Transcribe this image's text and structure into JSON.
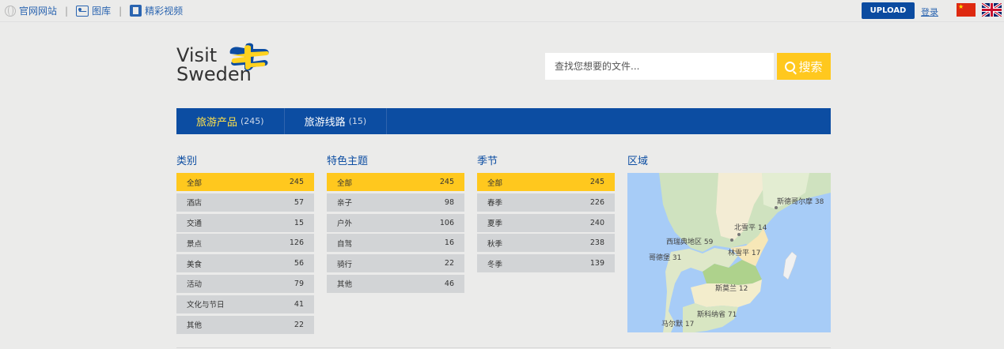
{
  "topbar": {
    "links": [
      {
        "label": "官网网站",
        "icon": "globe-icon"
      },
      {
        "label": "图库",
        "icon": "picture-icon"
      },
      {
        "label": "精彩视频",
        "icon": "film-icon"
      }
    ],
    "separator": "|",
    "upload_label": "UPLOAD",
    "login_label": "登录",
    "flags": [
      "china-flag-icon",
      "uk-flag-icon"
    ]
  },
  "header": {
    "logo_line1": "Visit",
    "logo_line2": "Sweden",
    "search_placeholder": "查找您想要的文件...",
    "search_button": "搜索"
  },
  "nav": {
    "tabs": [
      {
        "label": "旅游产品",
        "count": "(245)",
        "active": true
      },
      {
        "label": "旅游线路",
        "count": "(15)",
        "active": false
      }
    ]
  },
  "facets": [
    {
      "title": "类别",
      "items": [
        {
          "label": "全部",
          "count": "245",
          "selected": true
        },
        {
          "label": "酒店",
          "count": "57"
        },
        {
          "label": "交通",
          "count": "15"
        },
        {
          "label": "景点",
          "count": "126"
        },
        {
          "label": "美食",
          "count": "56"
        },
        {
          "label": "活动",
          "count": "79"
        },
        {
          "label": "文化与节日",
          "count": "41"
        },
        {
          "label": "其他",
          "count": "22"
        }
      ]
    },
    {
      "title": "特色主题",
      "items": [
        {
          "label": "全部",
          "count": "245",
          "selected": true
        },
        {
          "label": "亲子",
          "count": "98"
        },
        {
          "label": "户外",
          "count": "106"
        },
        {
          "label": "自驾",
          "count": "16"
        },
        {
          "label": "骑行",
          "count": "22"
        },
        {
          "label": "其他",
          "count": "46"
        }
      ]
    },
    {
      "title": "季节",
      "items": [
        {
          "label": "全部",
          "count": "245",
          "selected": true
        },
        {
          "label": "春季",
          "count": "226"
        },
        {
          "label": "夏季",
          "count": "240"
        },
        {
          "label": "秋季",
          "count": "238"
        },
        {
          "label": "冬季",
          "count": "139"
        }
      ]
    }
  ],
  "region": {
    "title": "区域",
    "labels": [
      {
        "name": "斯德哥尔摩",
        "count": "38"
      },
      {
        "name": "北雪平",
        "count": "14"
      },
      {
        "name": "西瑞典地区",
        "count": "59"
      },
      {
        "name": "林雪平",
        "count": "17"
      },
      {
        "name": "哥德堡",
        "count": "31"
      },
      {
        "name": "斯莫兰",
        "count": "12"
      },
      {
        "name": "斯科纳省",
        "count": "71"
      },
      {
        "name": "马尔默",
        "count": "17"
      }
    ]
  },
  "colors": {
    "brand_blue": "#0c4da2",
    "accent_yellow": "#ffc81e",
    "row_gray": "#d2d4d6"
  }
}
